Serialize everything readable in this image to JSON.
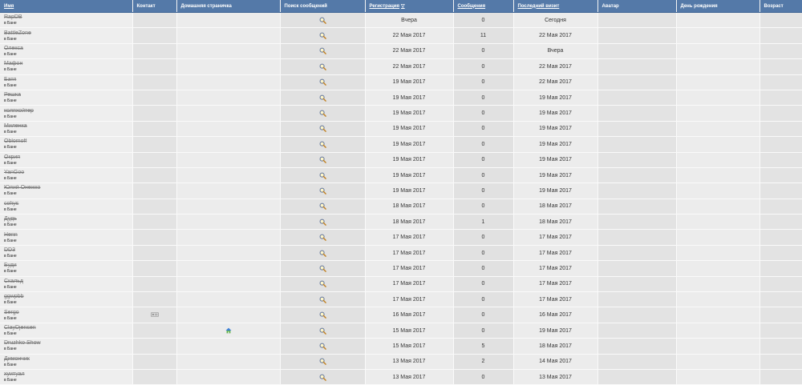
{
  "headers": {
    "name": "Имя",
    "contact": "Контакт",
    "homepage": "Домашняя страничка",
    "search": "Поиск сообщений",
    "registered": "Регистрация",
    "posts": "Сообщения",
    "last_visit": "Последний визит",
    "avatar": "Аватар",
    "birthday": "День рождения",
    "age": "Возраст"
  },
  "sort_indicator": "▽",
  "icons": {
    "search": "magnifier-icon",
    "homepage": "home-icon",
    "contact": "contact-icon"
  },
  "colors": {
    "header_bg": "#5479a8",
    "header_text": "#ffffff"
  },
  "rows": [
    {
      "name": "RapDB",
      "status": "в Бане",
      "contact": false,
      "home": false,
      "registered": "Вчера",
      "posts": "0",
      "last": "Сегодня"
    },
    {
      "name": "BattleZone",
      "status": "в Бане",
      "contact": false,
      "home": false,
      "registered": "22 Мая 2017",
      "posts": "11",
      "last": "22 Мая 2017"
    },
    {
      "name": "Олекса",
      "status": "в Бане",
      "contact": false,
      "home": false,
      "registered": "22 Мая 2017",
      "posts": "0",
      "last": "Вчера"
    },
    {
      "name": "Мафон",
      "status": "в Бане",
      "contact": false,
      "home": false,
      "registered": "22 Мая 2017",
      "posts": "0",
      "last": "22 Мая 2017"
    },
    {
      "name": "Батя",
      "status": "в Бане",
      "contact": false,
      "home": false,
      "registered": "19 Мая 2017",
      "posts": "0",
      "last": "22 Мая 2017"
    },
    {
      "name": "Решка",
      "status": "в Бане",
      "contact": false,
      "home": false,
      "registered": "19 Мая 2017",
      "posts": "0",
      "last": "19 Мая 2017"
    },
    {
      "name": "коляхойтер",
      "status": "в Бане",
      "contact": false,
      "home": false,
      "registered": "19 Мая 2017",
      "posts": "0",
      "last": "19 Мая 2017"
    },
    {
      "name": "Миленка",
      "status": "в Бане",
      "contact": false,
      "home": false,
      "registered": "19 Мая 2017",
      "posts": "0",
      "last": "19 Мая 2017"
    },
    {
      "name": "Oblomoff",
      "status": "в Бане",
      "contact": false,
      "home": false,
      "registered": "19 Мая 2017",
      "posts": "0",
      "last": "19 Мая 2017"
    },
    {
      "name": "Окрип",
      "status": "в Бане",
      "contact": false,
      "home": false,
      "registered": "19 Мая 2017",
      "posts": "0",
      "last": "19 Мая 2017"
    },
    {
      "name": "YanGoo",
      "status": "в Бане",
      "contact": false,
      "home": false,
      "registered": "19 Мая 2017",
      "posts": "0",
      "last": "19 Мая 2017"
    },
    {
      "name": "Юлий Онежко",
      "status": "в Бане",
      "contact": false,
      "home": false,
      "registered": "19 Мая 2017",
      "posts": "0",
      "last": "19 Мая 2017"
    },
    {
      "name": "cohys",
      "status": "в Бане",
      "contact": false,
      "home": false,
      "registered": "18 Мая 2017",
      "posts": "0",
      "last": "18 Мая 2017"
    },
    {
      "name": "Дудь",
      "status": "в Бане",
      "contact": false,
      "home": false,
      "registered": "18 Мая 2017",
      "posts": "1",
      "last": "18 Мая 2017"
    },
    {
      "name": "Henn",
      "status": "в Бане",
      "contact": false,
      "home": false,
      "registered": "17 Мая 2017",
      "posts": "0",
      "last": "17 Мая 2017"
    },
    {
      "name": "DD3",
      "status": "в Бане",
      "contact": false,
      "home": false,
      "registered": "17 Мая 2017",
      "posts": "0",
      "last": "17 Мая 2017"
    },
    {
      "name": "Буди",
      "status": "в Бане",
      "contact": false,
      "home": false,
      "registered": "17 Мая 2017",
      "posts": "0",
      "last": "17 Мая 2017"
    },
    {
      "name": "Скальд",
      "status": "в Бане",
      "contact": false,
      "home": false,
      "registered": "17 Мая 2017",
      "posts": "0",
      "last": "17 Мая 2017"
    },
    {
      "name": "ggwpbb",
      "status": "в Бане",
      "contact": false,
      "home": false,
      "registered": "17 Мая 2017",
      "posts": "0",
      "last": "17 Мая 2017"
    },
    {
      "name": "Sergo",
      "status": "в Бане",
      "contact": true,
      "home": false,
      "registered": "16 Мая 2017",
      "posts": "0",
      "last": "16 Мая 2017"
    },
    {
      "name": "ClayDjensen",
      "status": "в Бане",
      "contact": false,
      "home": true,
      "registered": "15 Мая 2017",
      "posts": "0",
      "last": "19 Мая 2017"
    },
    {
      "name": "Druzhko Show",
      "status": "в Бане",
      "contact": false,
      "home": false,
      "registered": "15 Мая 2017",
      "posts": "5",
      "last": "18 Мая 2017"
    },
    {
      "name": "Димончик",
      "status": "в Бане",
      "contact": false,
      "home": false,
      "registered": "13 Мая 2017",
      "posts": "2",
      "last": "14 Мая 2017"
    },
    {
      "name": "хуитуал",
      "status": "в Бане",
      "contact": false,
      "home": false,
      "registered": "13 Мая 2017",
      "posts": "0",
      "last": "13 Мая 2017"
    }
  ]
}
